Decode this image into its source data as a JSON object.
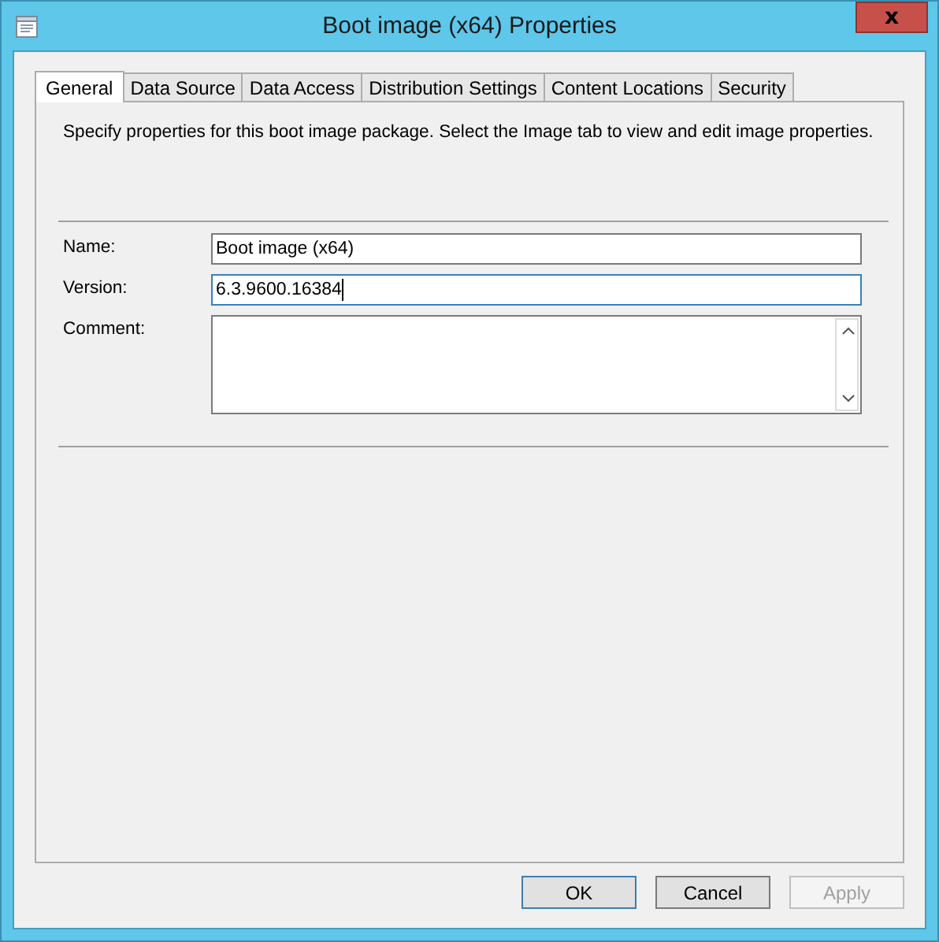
{
  "window": {
    "title": "Boot image (x64) Properties",
    "close": "x"
  },
  "tabs": [
    {
      "label": "General",
      "selected": true
    },
    {
      "label": "Data Source",
      "selected": false
    },
    {
      "label": "Data Access",
      "selected": false
    },
    {
      "label": "Distribution Settings",
      "selected": false
    },
    {
      "label": "Content Locations",
      "selected": false
    },
    {
      "label": "Security",
      "selected": false
    }
  ],
  "description": "Specify properties for this boot image package. Select the Image tab to view and edit image properties.",
  "fields": [
    {
      "label": "Name:",
      "kind": "text",
      "value": "Boot image (x64)",
      "focused": false
    },
    {
      "label": "Version:",
      "kind": "text",
      "value": "6.3.9600.16384",
      "focused": true
    },
    {
      "label": "Comment:",
      "kind": "multiline",
      "focused": false
    }
  ],
  "buttons": [
    {
      "label": "OK",
      "default": true,
      "disabled": false
    },
    {
      "label": "Cancel",
      "default": false,
      "disabled": false
    },
    {
      "label": "Apply",
      "default": false,
      "disabled": true
    }
  ]
}
